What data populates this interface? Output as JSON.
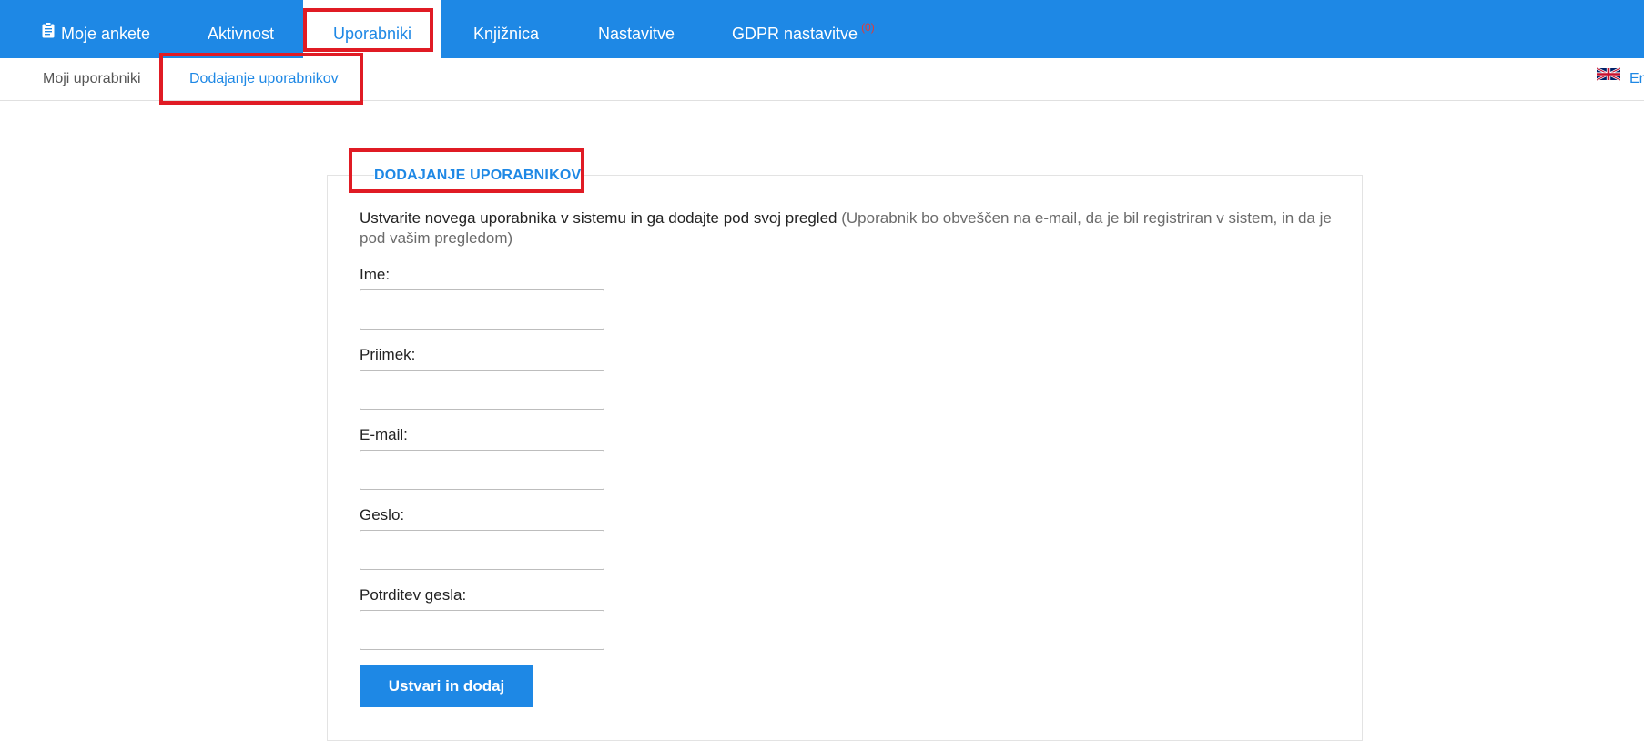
{
  "topnav": {
    "items": [
      {
        "label": "Moje ankete",
        "icon": "clipboard-icon"
      },
      {
        "label": "Aktivnost"
      },
      {
        "label": "Uporabniki",
        "active": true
      },
      {
        "label": "Knjižnica"
      },
      {
        "label": "Nastavitve"
      },
      {
        "label": "GDPR nastavitve",
        "badge": "(0)"
      }
    ]
  },
  "subnav": {
    "items": [
      {
        "label": "Moji uporabniki"
      },
      {
        "label": "Dodajanje uporabnikov",
        "active": true
      }
    ],
    "language": {
      "label": "En",
      "icon": "uk-flag-icon"
    }
  },
  "form": {
    "title": "DODAJANJE UPORABNIKOV",
    "intro": "Ustvarite novega uporabnika v sistemu in ga dodajte pod svoj pregled",
    "intro_note": "(Uporabnik bo obveščen na e-mail, da je bil registriran v sistem, in da je pod vašim pregledom)",
    "fields": [
      {
        "label": "Ime:",
        "value": ""
      },
      {
        "label": "Priimek:",
        "value": ""
      },
      {
        "label": "E-mail:",
        "value": ""
      },
      {
        "label": "Geslo:",
        "value": ""
      },
      {
        "label": "Potrditev gesla:",
        "value": ""
      }
    ],
    "submit_label": "Ustvari in dodaj"
  },
  "colors": {
    "brand": "#1e88e5",
    "highlight": "#e01b24",
    "badge": "#e53935"
  }
}
